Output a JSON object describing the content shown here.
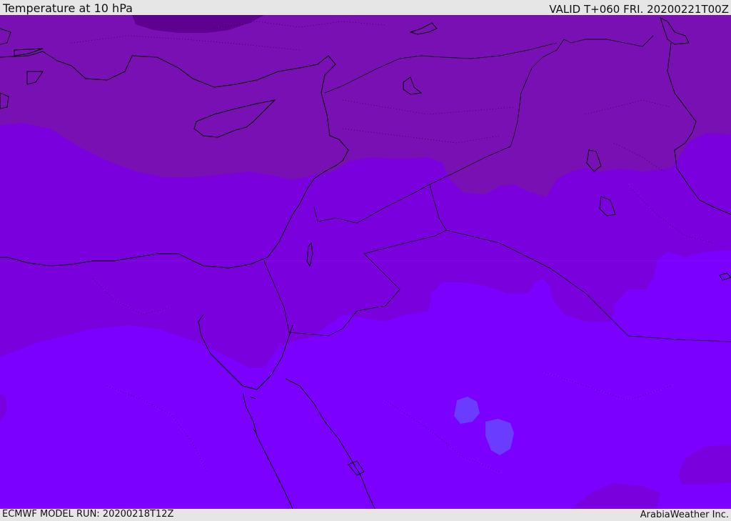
{
  "header": {
    "title": "Temperature at 10 hPa",
    "valid": "VALID T+060 FRI. 20200221T00Z"
  },
  "footer": {
    "model_run": "ECMWF MODEL RUN: 20200218T12Z",
    "credit": "ArabiaWeather Inc."
  },
  "colors": {
    "band_coldest": "#5e0090",
    "band_cold": "#7810b4",
    "band_mid": "#7a00de",
    "band_warm": "#7b00ff",
    "band_warmest": "#6a3cff",
    "outline": "#000000",
    "frame": "#e6e6e6"
  }
}
